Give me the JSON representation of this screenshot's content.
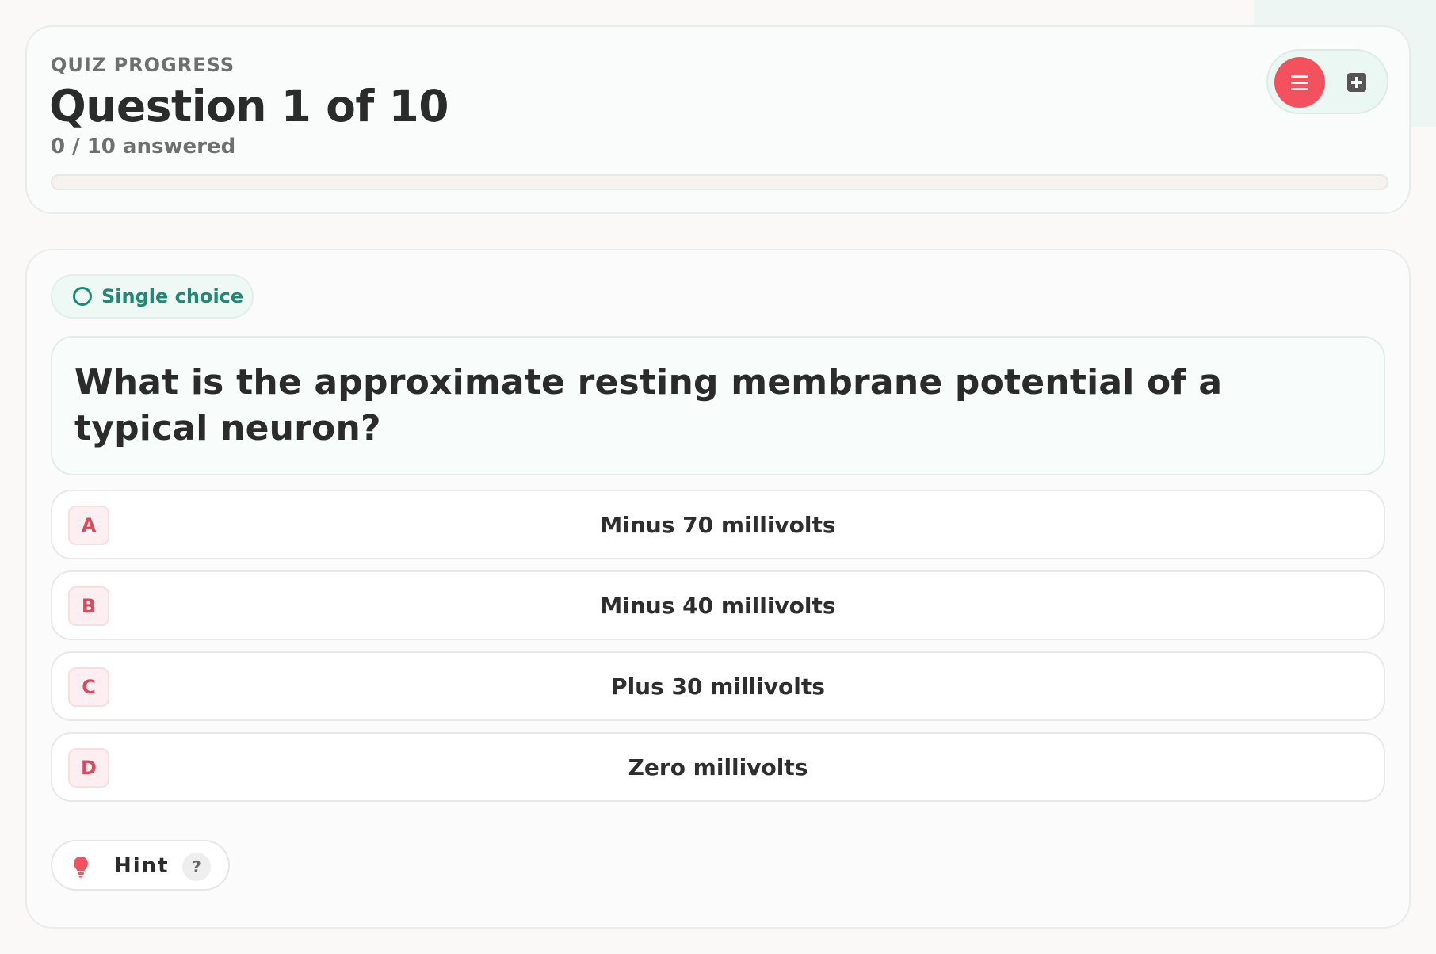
{
  "progress": {
    "eyebrow": "QUIZ PROGRESS",
    "title": "Question 1 of 10",
    "answered_text": "0 / 10 answered",
    "fraction_complete": 0
  },
  "toolbar": {
    "menu_icon": "hamburger-menu-icon",
    "add_icon": "add-square-icon"
  },
  "question": {
    "type_label": "Single choice",
    "text": "What is the approximate resting membrane potential of a typical neuron?",
    "options": [
      {
        "letter": "A",
        "text": "Minus 70 millivolts"
      },
      {
        "letter": "B",
        "text": "Minus 40 millivolts"
      },
      {
        "letter": "C",
        "text": "Plus 30 millivolts"
      },
      {
        "letter": "D",
        "text": "Zero millivolts"
      }
    ]
  },
  "hint": {
    "label": "Hint",
    "help_glyph": "?"
  },
  "colors": {
    "accent": "#f4515f",
    "teal": "#1f8a74",
    "letter_red": "#d84a5c"
  }
}
